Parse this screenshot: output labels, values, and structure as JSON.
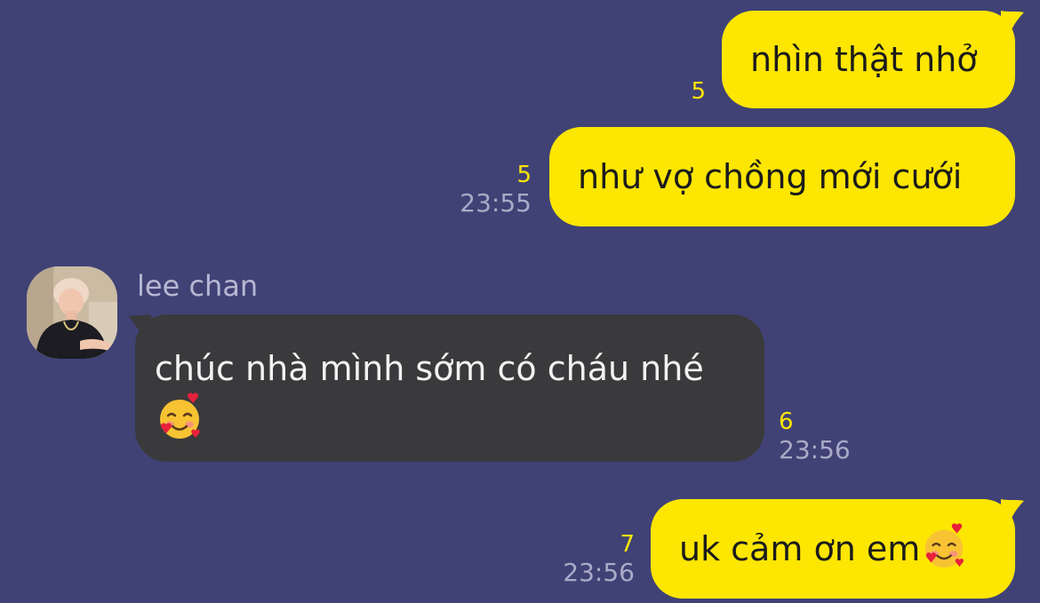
{
  "colors": {
    "background": "#404276",
    "outgoing_bubble": "#fde602",
    "incoming_bubble": "#3a3a3c",
    "unread_count": "#fde602",
    "timestamp": "#a9abc7"
  },
  "messages": [
    {
      "direction": "outgoing",
      "text": "nhìn thật nhở",
      "unread": "5",
      "time": ""
    },
    {
      "direction": "outgoing",
      "text": "như vợ chồng mới cưới",
      "unread": "5",
      "time": "23:55"
    },
    {
      "direction": "incoming",
      "sender": "lee chan",
      "text": "chúc nhà mình sớm có cháu nhé",
      "emoji": "smiling-face-with-hearts-icon",
      "unread": "6",
      "time": "23:56"
    },
    {
      "direction": "outgoing",
      "text": "uk cảm ơn em",
      "emoji": "smiling-face-with-hearts-icon",
      "unread": "7",
      "time": "23:56"
    }
  ]
}
